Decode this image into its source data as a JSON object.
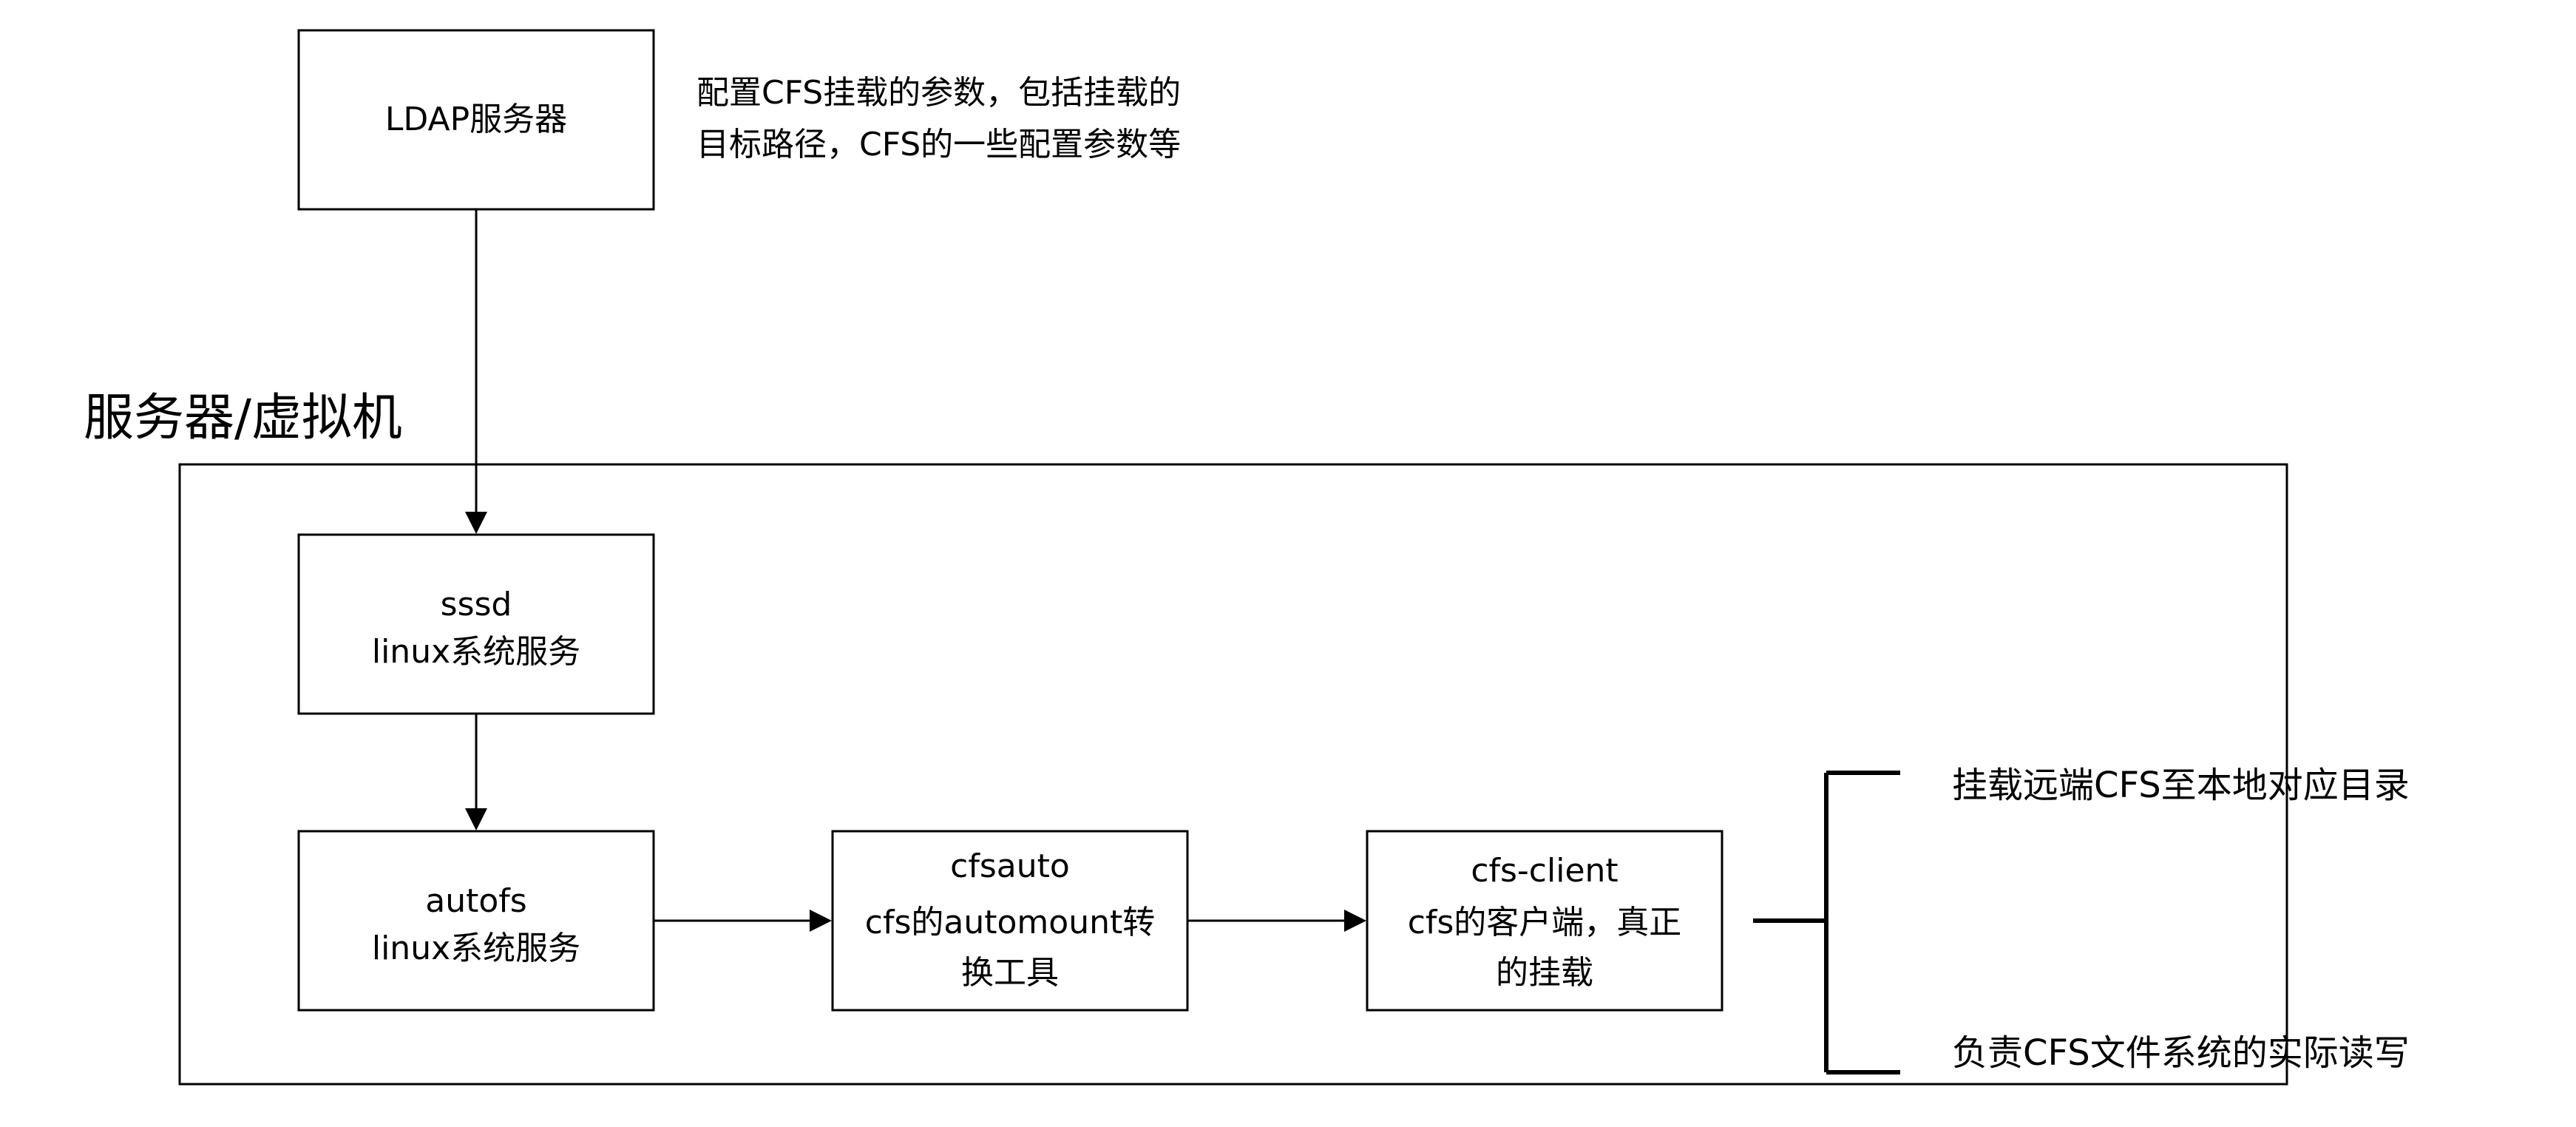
{
  "diagram": {
    "container": {
      "label": "服务器/虚拟机"
    },
    "nodes": {
      "ldap": {
        "lines": [
          "LDAP服务器"
        ]
      },
      "sssd": {
        "lines": [
          "sssd",
          "linux系统服务"
        ]
      },
      "autofs": {
        "lines": [
          "autofs",
          "linux系统服务"
        ]
      },
      "cfsauto": {
        "lines": [
          "cfsauto",
          "cfs的automount转",
          "换工具"
        ]
      },
      "cfsclient": {
        "lines": [
          "cfs-client",
          "cfs的客户端，真正",
          "的挂载"
        ]
      }
    },
    "notes": {
      "ldap_note": {
        "lines": [
          "配置CFS挂载的参数，包括挂载的",
          "目标路径，CFS的一些配置参数等"
        ]
      },
      "mount_note": "挂载远端CFS至本地对应目录",
      "rw_note": "负责CFS文件系统的实际读写"
    }
  }
}
